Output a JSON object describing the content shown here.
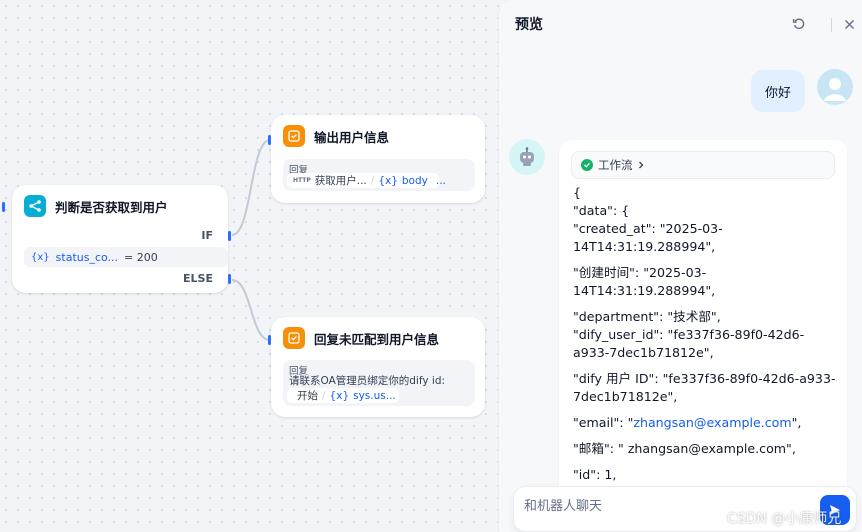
{
  "canvas": {
    "if_else_node": {
      "title": "判断是否获取到用户",
      "condition": {
        "variable": "status_co...",
        "operator": "= 200"
      },
      "if_label": "IF",
      "else_label": "ELSE"
    },
    "output_node": {
      "title": "输出用户信息",
      "reply_label": "回复",
      "pill_source_badge": "HTTP",
      "pill_source": "获取用户...",
      "pill_var": "body",
      "pill_more": "..."
    },
    "unmatched_node": {
      "title": "回复未匹配到用户信息",
      "reply_label": "回复",
      "reply_text": "请联系OA管理员绑定你的dify id:",
      "pill_source": "开始",
      "pill_var": "sys.us..."
    }
  },
  "preview": {
    "title": "预览",
    "user_message": "你好",
    "workflow_label": "工作流",
    "json_lines": [
      "{",
      "\"data\": {",
      "\"created_at\": \"2025-03-14T14:31:19.288994\",",
      "\"创建时间\": \"2025-03-14T14:31:19.288994\",",
      "\"department\": \"技术部\",",
      "\"dify_user_id\": \"fe337f36-89f0-42d6-a933-7dec1b71812e\",",
      "\"dify 用户 ID\": \"fe337f36-89f0-42d6-a933-7dec1b71812e\",",
      "\"email\": \"",
      "zhangsan@example.com",
      "\",",
      "\"邮箱\": \" zhangsan@example.com\",",
      "\"id\": 1,"
    ],
    "input_placeholder": "和机器人聊天"
  },
  "watermark": "CSDN @小康师兄",
  "colors": {
    "accent": "#155eef",
    "if_node_icon": "#06aed4",
    "answer_node_icon": "#f79009",
    "success": "#17b26a"
  },
  "icons": {
    "if_node": "branch-icon",
    "answer_node": "reply-icon",
    "refresh": "refresh-icon",
    "close": "close-icon",
    "send": "send-icon",
    "bot": "robot-icon",
    "variable": "variable-icon",
    "home": "home-icon"
  }
}
